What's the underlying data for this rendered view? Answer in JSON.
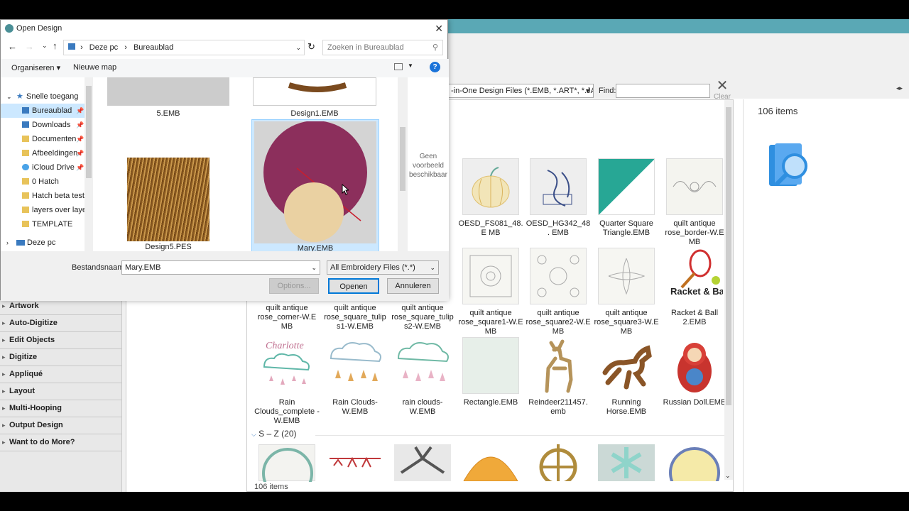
{
  "dialog": {
    "title": "Open Design",
    "nav_back": "←",
    "nav_forward": "→",
    "breadcrumb": [
      "Deze pc",
      "Bureaublad"
    ],
    "search_placeholder": "Zoeken in Bureaublad",
    "organize": "Organiseren ▾",
    "new_folder": "Nieuwe map",
    "nav_items": [
      {
        "label": "Snelle toegang",
        "pin": false
      },
      {
        "label": "Bureaublad",
        "pin": true
      },
      {
        "label": "Downloads",
        "pin": true
      },
      {
        "label": "Documenten",
        "pin": true
      },
      {
        "label": "Afbeeldingen",
        "pin": true
      },
      {
        "label": "iCloud Drive",
        "pin": true
      },
      {
        "label": "0 Hatch",
        "pin": false
      },
      {
        "label": "Hatch beta testing",
        "pin": false
      },
      {
        "label": "layers over layers",
        "pin": false
      },
      {
        "label": "TEMPLATE",
        "pin": false
      },
      {
        "label": "Deze pc",
        "pin": false
      }
    ],
    "files": [
      "5.EMB",
      "Design1.EMB",
      "Design5.PES",
      "Mary.EMB"
    ],
    "preview_text": "Geen voorbeeld beschikbaar",
    "filename_label": "Bestandsnaam:",
    "filename_value": "Mary.EMB",
    "filetype_value": "All Embroidery Files (*.*)",
    "options": "Options...",
    "open": "Openen",
    "cancel": "Annuleren"
  },
  "app": {
    "filetype_filter": "-in-One Design Files (*.EMB, *.ART*, *.JAN)",
    "find_label": "Find:",
    "clear_label": "Clear",
    "panel_items": [
      "Artwork",
      "Auto-Digitize",
      "Edit Objects",
      "Digitize",
      "Appliqué",
      "Layout",
      "Multi-Hooping",
      "Output Design",
      "Want to do More?"
    ],
    "partial_row_caption": "E",
    "row1": [
      "OESD_FS081_48.E MB",
      "OESD_HG342_48. EMB",
      "Quarter Square Triangle.EMB",
      "quilt antique rose_border-W.E MB"
    ],
    "row2": [
      "quilt antique rose_corner-W.E MB",
      "quilt antique rose_square_tulip s1-W.EMB",
      "quilt antique rose_square_tulip s2-W.EMB",
      "quilt antique rose_square1-W.E MB",
      "quilt antique rose_square2-W.E MB",
      "quilt antique rose_square3-W.E MB",
      "Racket & Ball 2.EMB"
    ],
    "row3": [
      "Rain Clouds_complete -W.EMB",
      "Rain Clouds-W.EMB",
      "rain clouds-W.EMB",
      "Rectangle.EMB",
      "Reindeer211457. emb",
      "Running Horse.EMB",
      "Russian Doll.EMB"
    ],
    "group_label": "S – Z (20)",
    "status": "106 items",
    "right_count": "106 items",
    "racket_text": "Racket & Ball",
    "charlotte": "Charlotte"
  }
}
